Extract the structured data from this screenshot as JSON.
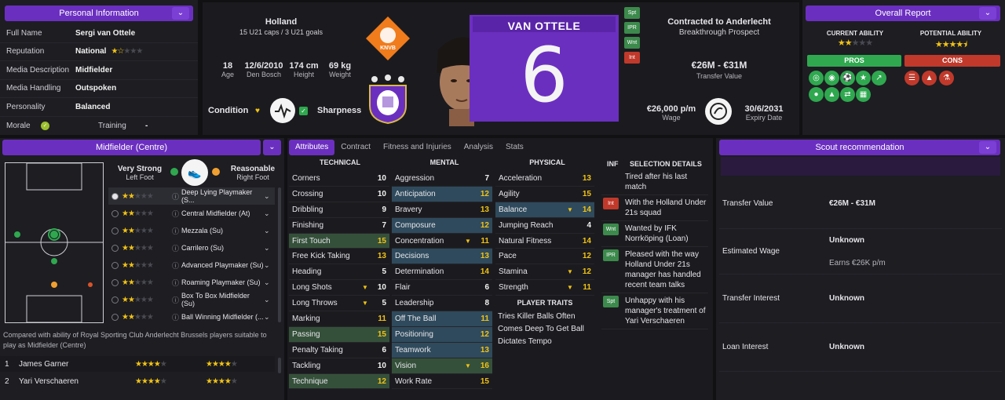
{
  "personal": {
    "title": "Personal Information",
    "rows": [
      {
        "k": "Full Name",
        "v": "Sergi van Ottele"
      },
      {
        "k": "Reputation",
        "v": "National"
      },
      {
        "k": "Media Description",
        "v": "Midfielder"
      },
      {
        "k": "Media Handling",
        "v": "Outspoken"
      },
      {
        "k": "Personality",
        "v": "Balanced"
      }
    ],
    "morale_label": "Morale",
    "training_label": "Training",
    "training_value": "-"
  },
  "header": {
    "nation": "Holland",
    "caps": "15 U21 caps / 3 U21 goals",
    "federation_badge": "KNVB",
    "age": "18",
    "age_label": "Age",
    "dob": "12/6/2010",
    "birthplace": "Den Bosch",
    "height": "174 cm",
    "height_label": "Height",
    "weight": "69 kg",
    "weight_label": "Weight",
    "condition_label": "Condition",
    "sharpness_label": "Sharpness",
    "shirt_name": "VAN OTTELE",
    "shirt_number": "6",
    "tags": [
      {
        "label": "Spt",
        "color": "#3c8a4c"
      },
      {
        "label": "IPR",
        "color": "#3c8a4c"
      },
      {
        "label": "Wnt",
        "color": "#3c8a4c"
      },
      {
        "label": "Int",
        "color": "#c0392b"
      }
    ],
    "contract": "Contracted to Anderlecht",
    "contract_sub": "Breakthrough Prospect",
    "transfer_value": "€26M - €31M",
    "transfer_value_label": "Transfer Value",
    "wage": "€26,000 p/m",
    "wage_label": "Wage",
    "expiry": "30/6/2031",
    "expiry_label": "Expiry Date"
  },
  "overall": {
    "title": "Overall Report",
    "current_label": "CURRENT ABILITY",
    "potential_label": "POTENTIAL ABILITY",
    "current_stars": 2,
    "potential_stars": 4.5,
    "pros_label": "PROS",
    "cons_label": "CONS"
  },
  "position": {
    "title": "Midfielder (Centre)",
    "foot_left_rating": "Very Strong",
    "foot_left_label": "Left Foot",
    "foot_right_rating": "Reasonable",
    "foot_right_label": "Right Foot",
    "roles": [
      {
        "name": "Deep Lying Playmaker (S...",
        "stars": 2
      },
      {
        "name": "Central Midfielder (At)",
        "stars": 2
      },
      {
        "name": "Mezzala (Su)",
        "stars": 2
      },
      {
        "name": "Carrilero (Su)",
        "stars": 2
      },
      {
        "name": "Advanced Playmaker (Su)",
        "stars": 2
      },
      {
        "name": "Roaming Playmaker (Su)",
        "stars": 2
      },
      {
        "name": "Box To Box Midfielder (Su)",
        "stars": 2
      },
      {
        "name": "Ball Winning Midfielder (...",
        "stars": 2
      }
    ],
    "compare_text": "Compared with ability of Royal Sporting Club Anderlecht Brussels players suitable to play as Midfielder (Centre)",
    "compare": [
      {
        "rank": "1",
        "name": "James Garner"
      },
      {
        "rank": "2",
        "name": "Yari Verschaeren"
      }
    ]
  },
  "tabs": [
    "Attributes",
    "Contract",
    "Fitness and Injuries",
    "Analysis",
    "Stats"
  ],
  "attributes": {
    "technical_label": "TECHNICAL",
    "mental_label": "MENTAL",
    "physical_label": "PHYSICAL",
    "traits_label": "PLAYER TRAITS",
    "technical": [
      {
        "n": "Corners",
        "v": "10"
      },
      {
        "n": "Crossing",
        "v": "10"
      },
      {
        "n": "Dribbling",
        "v": "9"
      },
      {
        "n": "Finishing",
        "v": "7"
      },
      {
        "n": "First Touch",
        "v": "15",
        "hl": "g"
      },
      {
        "n": "Free Kick Taking",
        "v": "13"
      },
      {
        "n": "Heading",
        "v": "5"
      },
      {
        "n": "Long Shots",
        "v": "10",
        "arrow": "▼"
      },
      {
        "n": "Long Throws",
        "v": "5",
        "arrow": "▼"
      },
      {
        "n": "Marking",
        "v": "11"
      },
      {
        "n": "Passing",
        "v": "15",
        "hl": "g"
      },
      {
        "n": "Penalty Taking",
        "v": "6"
      },
      {
        "n": "Tackling",
        "v": "10"
      },
      {
        "n": "Technique",
        "v": "12",
        "hl": "g"
      }
    ],
    "mental": [
      {
        "n": "Aggression",
        "v": "7"
      },
      {
        "n": "Anticipation",
        "v": "12",
        "hl": "b"
      },
      {
        "n": "Bravery",
        "v": "13"
      },
      {
        "n": "Composure",
        "v": "12",
        "hl": "b"
      },
      {
        "n": "Concentration",
        "v": "11",
        "arrow": "▼"
      },
      {
        "n": "Decisions",
        "v": "13",
        "hl": "b"
      },
      {
        "n": "Determination",
        "v": "14"
      },
      {
        "n": "Flair",
        "v": "6"
      },
      {
        "n": "Leadership",
        "v": "8"
      },
      {
        "n": "Off The Ball",
        "v": "11",
        "hl": "b"
      },
      {
        "n": "Positioning",
        "v": "12",
        "hl": "b"
      },
      {
        "n": "Teamwork",
        "v": "13",
        "hl": "b"
      },
      {
        "n": "Vision",
        "v": "16",
        "hl": "g",
        "arrow": "▼"
      },
      {
        "n": "Work Rate",
        "v": "15"
      }
    ],
    "physical": [
      {
        "n": "Acceleration",
        "v": "13"
      },
      {
        "n": "Agility",
        "v": "15"
      },
      {
        "n": "Balance",
        "v": "14",
        "hl": "b",
        "arrow": "▼"
      },
      {
        "n": "Jumping Reach",
        "v": "4"
      },
      {
        "n": "Natural Fitness",
        "v": "14"
      },
      {
        "n": "Pace",
        "v": "12"
      },
      {
        "n": "Stamina",
        "v": "12",
        "arrow": "▼"
      },
      {
        "n": "Strength",
        "v": "11",
        "arrow": "▼"
      }
    ],
    "traits": [
      "Tries Killer Balls Often",
      "Comes Deep To Get Ball",
      "Dictates Tempo"
    ]
  },
  "selection": {
    "inf_label": "INF",
    "title": "SELECTION DETAILS",
    "items": [
      {
        "tag": "",
        "text": "Tired after his last match"
      },
      {
        "tag": "Int",
        "tag_color": "#c0392b",
        "text": "With the Holland Under 21s squad"
      },
      {
        "tag": "Wnt",
        "tag_color": "#3c8a4c",
        "text": "Wanted by IFK Norrköping (Loan)"
      },
      {
        "tag": "IPR",
        "tag_color": "#3c8a4c",
        "text": "Pleased with the way Holland Under 21s manager has handled recent team talks"
      },
      {
        "tag": "Spt",
        "tag_color": "#3c8a4c",
        "text": "Unhappy with his manager's treatment of Yari Verschaeren"
      }
    ]
  },
  "scout": {
    "title": "Scout recommendation",
    "rows": [
      {
        "k": "Transfer Value",
        "v": "€26M - €31M",
        "sub": ""
      },
      {
        "k": "Estimated Wage",
        "v": "Unknown",
        "sub": "Earns €26K p/m"
      },
      {
        "k": "Transfer Interest",
        "v": "Unknown",
        "sub": ""
      },
      {
        "k": "Loan Interest",
        "v": "Unknown",
        "sub": ""
      }
    ]
  },
  "colors": {
    "accent": "#6b2fc0",
    "green": "#2fa84f",
    "red": "#c0392b",
    "gold": "#f2c314"
  }
}
